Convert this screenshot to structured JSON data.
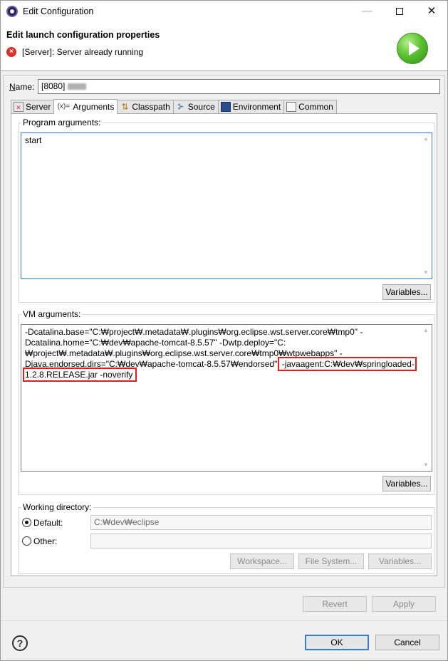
{
  "window": {
    "title": "Edit Configuration",
    "minimize": "—",
    "close": "✕"
  },
  "header": {
    "title": "Edit launch configuration properties",
    "message": "[Server]: Server already running"
  },
  "name_field": {
    "label": "Name:",
    "value": "[8080]"
  },
  "tabs": [
    {
      "label": "Server",
      "icon": "server-icon"
    },
    {
      "label": "Arguments",
      "icon": "arguments-icon",
      "active": true
    },
    {
      "label": "Classpath",
      "icon": "classpath-icon"
    },
    {
      "label": "Source",
      "icon": "source-icon"
    },
    {
      "label": "Environment",
      "icon": "environment-icon"
    },
    {
      "label": "Common",
      "icon": "common-icon"
    }
  ],
  "program_arguments": {
    "label": "Program arguments:",
    "value": "start",
    "variables_button": "Variables..."
  },
  "vm_arguments": {
    "label": "VM arguments:",
    "value_prefix": "-Dcatalina.base=\"C:₩project₩.metadata₩.plugins₩org.eclipse.wst.server.core₩tmp0\" -Dcatalina.home=\"C:₩dev₩apache-tomcat-8.5.57\" -Dwtp.deploy=\"C:₩project₩.metadata₩.plugins₩org.eclipse.wst.server.core₩tmp0₩wtpwebapps\" -Djava.endorsed.dirs=\"C:₩dev₩apache-tomcat-8.5.57₩endorsed\"",
    "value_highlighted": "-javaagent:C:₩dev₩springloaded-1.2.8.RELEASE.jar -noverify",
    "variables_button": "Variables..."
  },
  "working_directory": {
    "label": "Working directory:",
    "default_label": "Default:",
    "default_value": "C:₩dev₩eclipse",
    "other_label": "Other:",
    "other_value": "",
    "workspace_button": "Workspace...",
    "filesystem_button": "File System...",
    "variables_button": "Variables..."
  },
  "actions": {
    "revert": "Revert",
    "apply": "Apply",
    "ok": "OK",
    "cancel": "Cancel"
  },
  "colors": {
    "accent": "#3b7bd0",
    "highlight_box": "#e11d1d",
    "error": "#d9302b",
    "run_green": "#5cc332"
  }
}
